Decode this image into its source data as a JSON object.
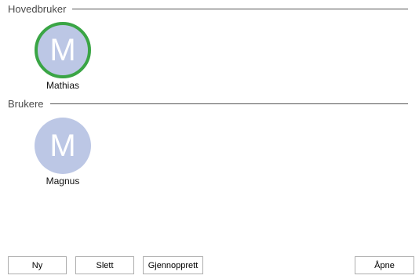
{
  "main_user_section": {
    "title": "Hovedbruker",
    "user": {
      "initial": "M",
      "name": "Mathias",
      "selected": true
    }
  },
  "users_section": {
    "title": "Brukere",
    "users": [
      {
        "initial": "M",
        "name": "Magnus",
        "selected": false
      }
    ]
  },
  "buttons": {
    "new": "Ny",
    "delete": "Slett",
    "restore": "Gjennopprett",
    "open": "Åpne"
  },
  "colors": {
    "avatar_fill": "#bcc7e5",
    "selected_ring": "#3aa545"
  }
}
